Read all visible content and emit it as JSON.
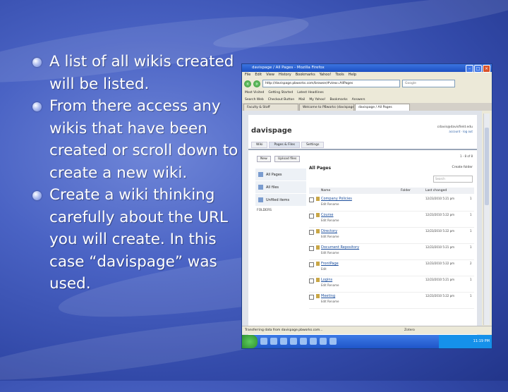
{
  "bullets": [
    "A list of all wikis created will be listed.",
    "From there access any wikis that have been created or scroll down to create a new wiki.",
    "Create a wiki thinking carefully about the URL you will create. In this case “davispage” was used."
  ],
  "screenshot": {
    "window_title": "davispage / All Pages - Mozilla Firefox",
    "menu": [
      "File",
      "Edit",
      "View",
      "History",
      "Bookmarks",
      "Yahoo!",
      "Tools",
      "Help"
    ],
    "url": "http://davispage.pbworks.com/browse/#view=AllPages",
    "search_placeholder": "Google",
    "bookmarks": [
      "Most Visited",
      "Getting Started",
      "Latest Headlines"
    ],
    "toolbar": [
      "Search Web",
      "Checkout Button",
      "Mail",
      "My Yahoo!",
      "Bookmarks",
      "Answers"
    ],
    "tabs": [
      "Faculty & Staff",
      "Welcome to PBworks (davispage)",
      "davispage / All Pages"
    ],
    "site_title": "davispage",
    "user_email": "cdavis@davisfield.edu",
    "user_links": "account · log out",
    "nav_tabs": [
      "Wiki",
      "Pages & Files",
      "Settings"
    ],
    "new_button": "New",
    "upload_button": "Upload files",
    "count_text": "1 - 8 of 8",
    "sidebar": {
      "all_pages": "All Pages",
      "all_files": "All files",
      "unfiled": "Unfiled items",
      "folders": "FOLDERS"
    },
    "main_title": "All Pages",
    "create_folder": "Create folder",
    "search": "Search",
    "columns": {
      "name": "Name",
      "folder": "Folder",
      "modified": "Last changed"
    },
    "rows": [
      {
        "name": "Company Policies",
        "actions": "Edit  Rename",
        "modified": "12/23/2010  5:21 pm",
        "ver": "1"
      },
      {
        "name": "Course",
        "actions": "Edit  Rename",
        "modified": "12/23/2010  5:22 pm",
        "ver": "1"
      },
      {
        "name": "Directory",
        "actions": "Edit  Rename",
        "modified": "12/23/2010  5:22 pm",
        "ver": "1"
      },
      {
        "name": "Document Repository",
        "actions": "Edit  Rename",
        "modified": "12/23/2010  5:21 pm",
        "ver": "1"
      },
      {
        "name": "FrontPage",
        "actions": "Edit",
        "modified": "12/23/2010  5:22 pm",
        "ver": "2"
      },
      {
        "name": "Logins",
        "actions": "Edit  Rename",
        "modified": "12/23/2010  5:21 pm",
        "ver": "1"
      },
      {
        "name": "Meeting",
        "actions": "Edit  Rename",
        "modified": "12/23/2010  5:22 pm",
        "ver": "1"
      }
    ],
    "status": "Transferring data from davispage.pbworks.com...",
    "zotero": "Zotero",
    "clock": "11:19 PM"
  }
}
